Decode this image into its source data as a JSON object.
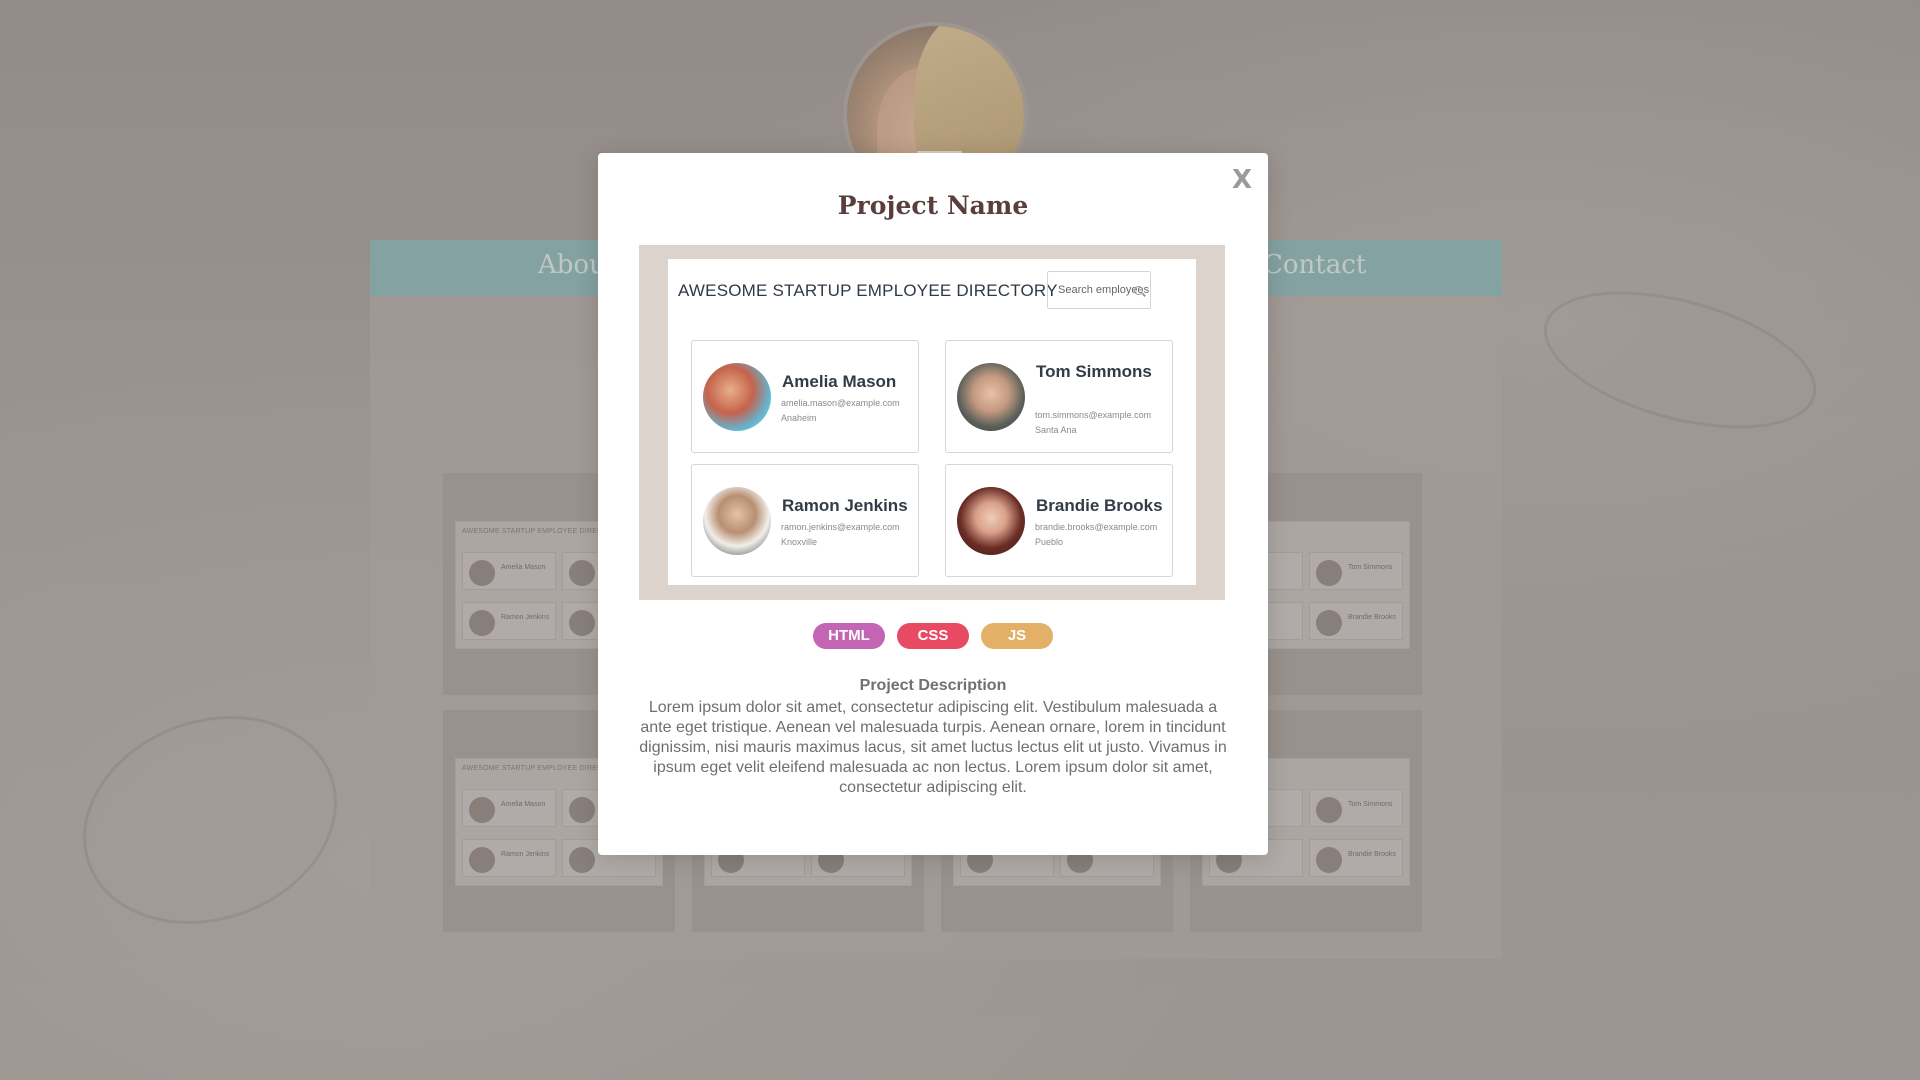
{
  "background": {
    "nav": {
      "about_label": "About",
      "contact_label": "Contact"
    },
    "thumbnail_title": "AWESOME STARTUP EMPLOYEE DIRECTORY",
    "thumbnail_names": [
      "Amelia Mason",
      "Tom Simmons",
      "Ramon Jenkins",
      "Brandie Brooks"
    ]
  },
  "modal": {
    "close_label": "X",
    "title": "Project Name",
    "preview": {
      "heading": "AWESOME STARTUP EMPLOYEE DIRECTORY",
      "search_placeholder": "Search employees",
      "employees": [
        {
          "name": "Amelia Mason",
          "email": "amelia.mason@example.com",
          "city": "Anaheim"
        },
        {
          "name": "Tom Simmons",
          "email": "tom.simmons@example.com",
          "city": "Santa Ana"
        },
        {
          "name": "Ramon Jenkins",
          "email": "ramon.jenkins@example.com",
          "city": "Knoxville"
        },
        {
          "name": "Brandie Brooks",
          "email": "brandie.brooks@example.com",
          "city": "Pueblo"
        }
      ]
    },
    "tags": [
      {
        "label": "HTML",
        "color": "#c464b4"
      },
      {
        "label": "CSS",
        "color": "#e84a63"
      },
      {
        "label": "JS",
        "color": "#e2b067"
      }
    ],
    "description_title": "Project Description",
    "description_body": "Lorem ipsum dolor sit amet, consectetur adipiscing elit. Vestibulum malesuada a ante eget tristique. Aenean vel malesuada turpis. Aenean ornare, lorem in tincidunt dignissim, nisi mauris maximus lacus, sit amet luctus lectus elit ut justo. Vivamus in ipsum eget velit eleifend malesuada ac non lectus. Lorem ipsum dolor sit amet, consectetur adipiscing elit."
  }
}
